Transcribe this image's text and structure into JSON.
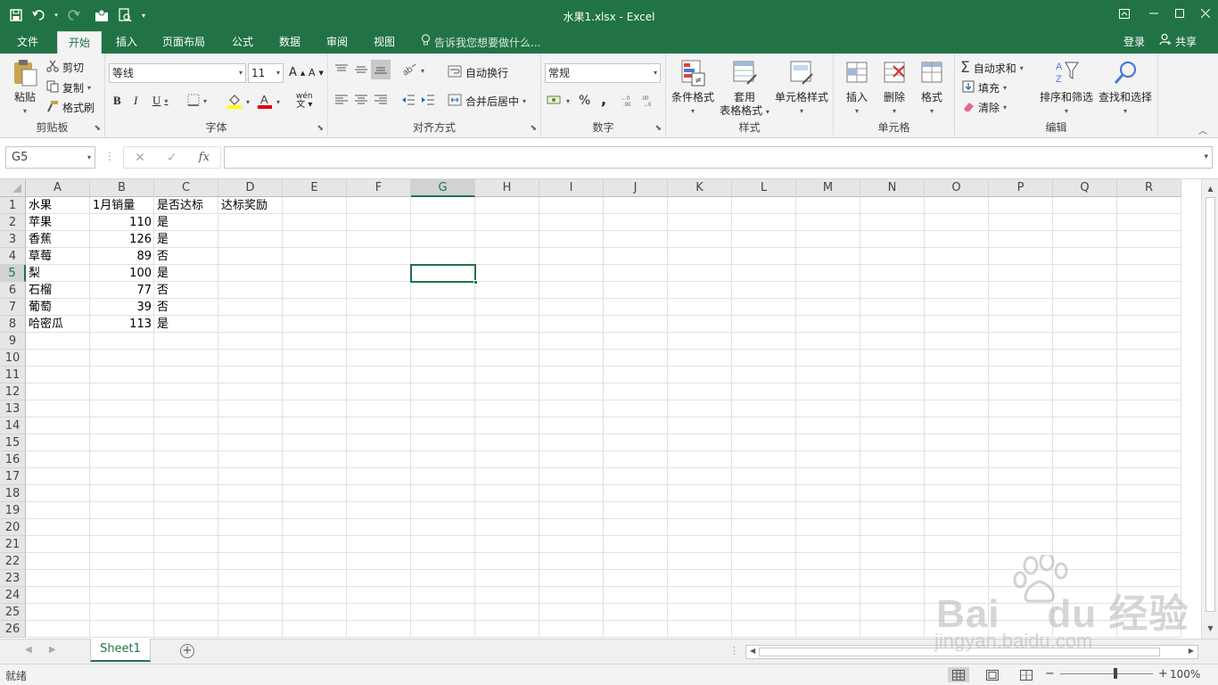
{
  "window": {
    "title": "水果1.xlsx - Excel"
  },
  "tabs": [
    "文件",
    "开始",
    "插入",
    "页面布局",
    "公式",
    "数据",
    "审阅",
    "视图"
  ],
  "tell_me": "告诉我您想要做什么...",
  "account": {
    "login": "登录",
    "share": "共享"
  },
  "ribbon": {
    "clipboard": {
      "label": "剪贴板",
      "paste": "粘贴",
      "cut": "剪切",
      "copy": "复制",
      "format_painter": "格式刷"
    },
    "font": {
      "label": "字体",
      "name": "等线",
      "size": "11",
      "bold": "B",
      "italic": "I",
      "underline": "U",
      "grow": "A",
      "shrink": "A",
      "phonetic": "wén"
    },
    "alignment": {
      "label": "对齐方式",
      "wrap": "自动换行",
      "merge": "合并后居中"
    },
    "number": {
      "label": "数字",
      "format": "常规",
      "percent": "%",
      "comma": ","
    },
    "styles": {
      "label": "样式",
      "conditional": "条件格式",
      "table_line1": "套用",
      "table_line2": "表格格式",
      "cell_styles": "单元格样式"
    },
    "cells": {
      "label": "单元格",
      "insert": "插入",
      "delete": "删除",
      "format": "格式"
    },
    "editing": {
      "label": "编辑",
      "autosum": "自动求和",
      "fill": "填充",
      "clear": "清除",
      "sort_filter": "排序和筛选",
      "find_select": "查找和选择"
    }
  },
  "formula_bar": {
    "name_box": "G5",
    "fx": "fx",
    "content": ""
  },
  "columns": [
    "A",
    "B",
    "C",
    "D",
    "E",
    "F",
    "G",
    "H",
    "I",
    "J",
    "K",
    "L",
    "M",
    "N",
    "O",
    "P",
    "Q",
    "R"
  ],
  "rows": [
    "1",
    "2",
    "3",
    "4",
    "5",
    "6",
    "7",
    "8",
    "9",
    "10",
    "11",
    "12",
    "13",
    "14",
    "15",
    "16",
    "17",
    "18",
    "19",
    "20",
    "21",
    "22",
    "23",
    "24",
    "25",
    "26"
  ],
  "selected": {
    "column": "G",
    "row": "5"
  },
  "table": {
    "headers": [
      "水果",
      "1月销量",
      "是否达标",
      "达标奖励"
    ],
    "data": [
      [
        "苹果",
        "110",
        "是"
      ],
      [
        "香蕉",
        "126",
        "是"
      ],
      [
        "草莓",
        "89",
        "否"
      ],
      [
        "梨",
        "100",
        "是"
      ],
      [
        "石榴",
        "77",
        "否"
      ],
      [
        "葡萄",
        "39",
        "否"
      ],
      [
        "哈密瓜",
        "113",
        "是"
      ]
    ]
  },
  "sheets": [
    "Sheet1"
  ],
  "status": {
    "ready": "就绪",
    "zoom": "100%"
  },
  "watermark": {
    "logo_text": "Bai du 经验",
    "url": "jingyan.baidu.com"
  },
  "colors": {
    "excel_green": "#217346",
    "ribbon_bg": "#f3f3f3",
    "header_bg": "#e6e6e6"
  }
}
